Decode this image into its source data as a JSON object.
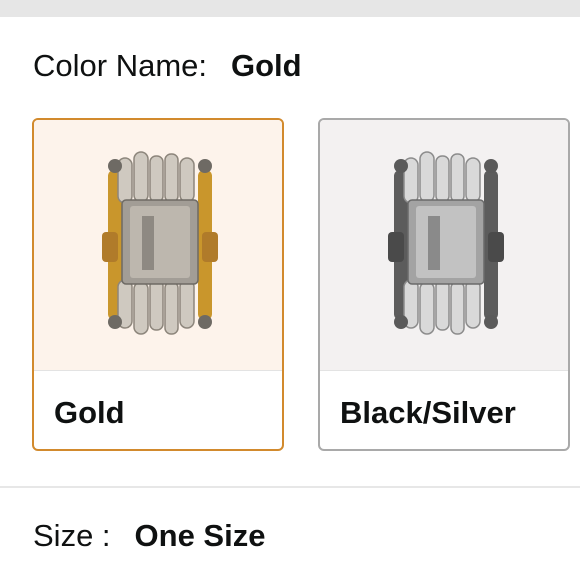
{
  "color": {
    "label": "Color Name:",
    "selected": "Gold"
  },
  "swatches": [
    {
      "name": "Gold",
      "selected": true,
      "tool_icon": "multi-tool-gold-image"
    },
    {
      "name": "Black/Silver",
      "selected": false,
      "tool_icon": "multi-tool-silver-image"
    }
  ],
  "size": {
    "label": "Size :",
    "selected": "One Size"
  },
  "colors": {
    "selected_border": "#d28a2d",
    "unselected_border": "#a9a9a9",
    "gold_bg": "#fdf3eb",
    "silver_bg": "#f3f1f1"
  }
}
